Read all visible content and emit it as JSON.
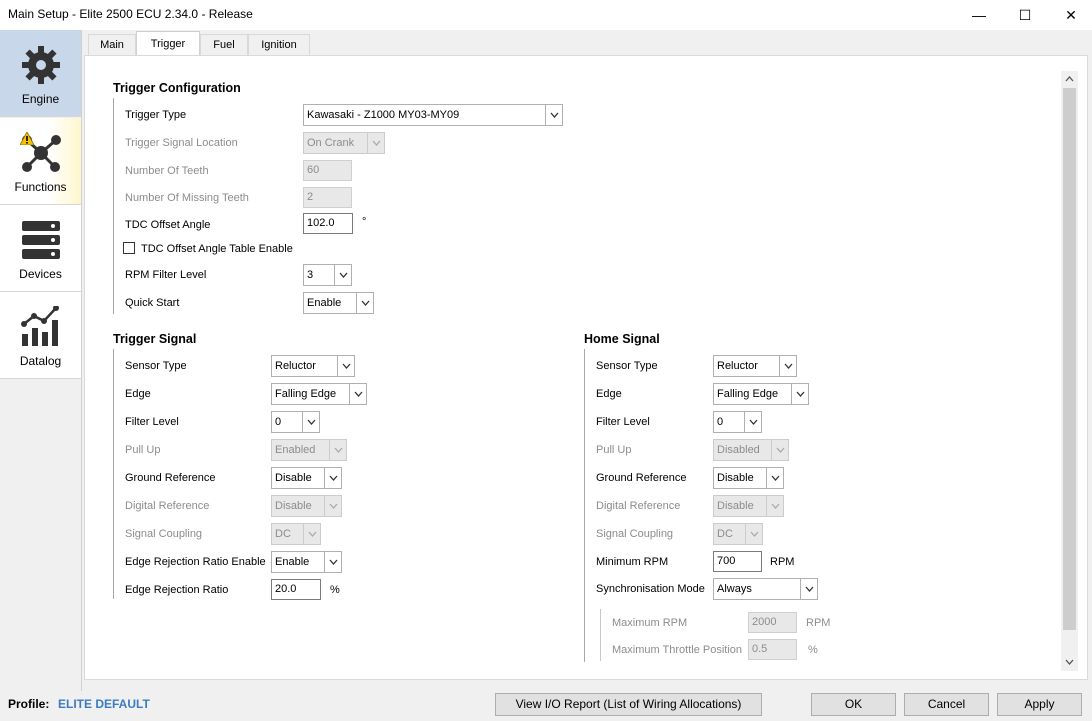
{
  "window": {
    "title": "Main Setup - Elite 2500 ECU 2.34.0 - Release",
    "minimize": "—",
    "maximize": "☐",
    "close": "✕"
  },
  "sidebar": {
    "items": [
      {
        "label": "Engine",
        "icon": "engine-icon",
        "active": true
      },
      {
        "label": "Functions",
        "icon": "functions-icon",
        "warning": true
      },
      {
        "label": "Devices",
        "icon": "devices-icon"
      },
      {
        "label": "Datalog",
        "icon": "datalog-icon"
      }
    ]
  },
  "tabs": [
    {
      "label": "Main"
    },
    {
      "label": "Trigger",
      "active": true
    },
    {
      "label": "Fuel"
    },
    {
      "label": "Ignition"
    }
  ],
  "trigger_config": {
    "title": "Trigger Configuration",
    "trigger_type": {
      "label": "Trigger Type",
      "value": "Kawasaki - Z1000 MY03-MY09"
    },
    "signal_location": {
      "label": "Trigger Signal Location",
      "value": "On Crank"
    },
    "num_teeth": {
      "label": "Number Of Teeth",
      "value": "60"
    },
    "num_missing": {
      "label": "Number Of Missing Teeth",
      "value": "2"
    },
    "tdc_offset": {
      "label": "TDC Offset Angle",
      "value": "102.0",
      "unit": "°"
    },
    "tdc_table": {
      "label": "TDC Offset Angle Table Enable",
      "checked": false
    },
    "rpm_filter": {
      "label": "RPM Filter Level",
      "value": "3"
    },
    "quick_start": {
      "label": "Quick Start",
      "value": "Enable"
    }
  },
  "trigger_signal": {
    "title": "Trigger Signal",
    "sensor_type": {
      "label": "Sensor Type",
      "value": "Reluctor"
    },
    "edge": {
      "label": "Edge",
      "value": "Falling Edge"
    },
    "filter_level": {
      "label": "Filter Level",
      "value": "0"
    },
    "pull_up": {
      "label": "Pull Up",
      "value": "Enabled"
    },
    "ground_ref": {
      "label": "Ground Reference",
      "value": "Disable"
    },
    "digital_ref": {
      "label": "Digital Reference",
      "value": "Disable"
    },
    "signal_coupling": {
      "label": "Signal Coupling",
      "value": "DC"
    },
    "edge_rej_enable": {
      "label": "Edge Rejection Ratio Enable",
      "value": "Enable"
    },
    "edge_rej_ratio": {
      "label": "Edge Rejection Ratio",
      "value": "20.0",
      "unit": "%"
    }
  },
  "home_signal": {
    "title": "Home Signal",
    "sensor_type": {
      "label": "Sensor Type",
      "value": "Reluctor"
    },
    "edge": {
      "label": "Edge",
      "value": "Falling Edge"
    },
    "filter_level": {
      "label": "Filter Level",
      "value": "0"
    },
    "pull_up": {
      "label": "Pull Up",
      "value": "Disabled"
    },
    "ground_ref": {
      "label": "Ground Reference",
      "value": "Disable"
    },
    "digital_ref": {
      "label": "Digital Reference",
      "value": "Disable"
    },
    "signal_coupling": {
      "label": "Signal Coupling",
      "value": "DC"
    },
    "min_rpm": {
      "label": "Minimum RPM",
      "value": "700",
      "unit": "RPM"
    },
    "sync_mode": {
      "label": "Synchronisation Mode",
      "value": "Always"
    },
    "max_rpm": {
      "label": "Maximum RPM",
      "value": "2000",
      "unit": "RPM"
    },
    "max_throttle": {
      "label": "Maximum Throttle Position",
      "value": "0.5",
      "unit": "%"
    }
  },
  "footer": {
    "profile_label": "Profile:",
    "profile_value": "ELITE DEFAULT",
    "io_report": "View I/O Report (List of Wiring Allocations)",
    "ok": "OK",
    "cancel": "Cancel",
    "apply": "Apply"
  },
  "colors": {
    "accent": "#3c7bc4",
    "sidebar_active": "#c9d7ea"
  }
}
